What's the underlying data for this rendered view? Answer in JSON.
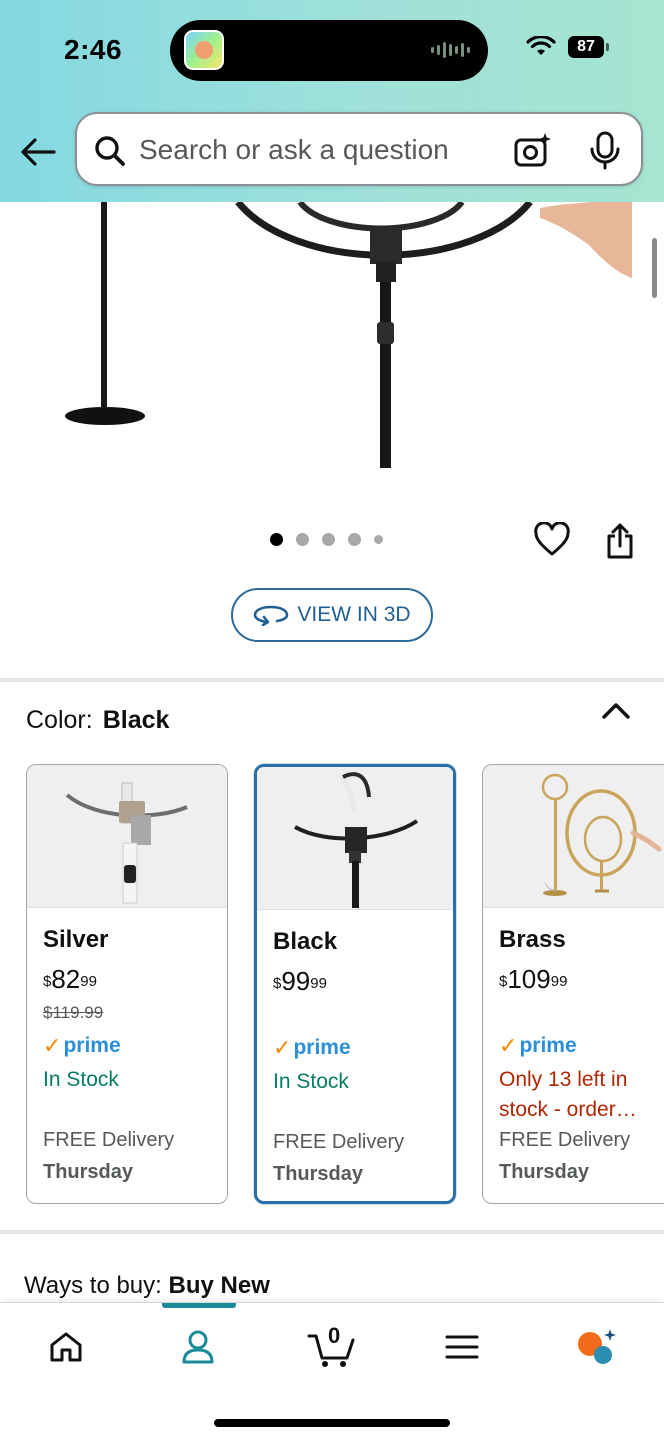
{
  "status_bar": {
    "time": "2:46",
    "battery": "87"
  },
  "header": {
    "search_placeholder": "Search or ask a question"
  },
  "product_view": {
    "view_3d_label": "VIEW IN 3D",
    "image_count": 5,
    "active_image": 1
  },
  "color_selector": {
    "label": "Color:",
    "selected": "Black",
    "options": [
      {
        "name": "Silver",
        "price_symbol": "$",
        "price_whole": "82",
        "price_fraction": "99",
        "list_price": "$119.99",
        "prime": "prime",
        "stock": "In Stock",
        "stock_status": "in-stock",
        "delivery": "FREE Delivery",
        "delivery_day": "Thursday"
      },
      {
        "name": "Black",
        "price_symbol": "$",
        "price_whole": "99",
        "price_fraction": "99",
        "list_price": "",
        "prime": "prime",
        "stock": "In Stock",
        "stock_status": "in-stock",
        "delivery": "FREE Delivery",
        "delivery_day": "Thursday"
      },
      {
        "name": "Brass",
        "price_symbol": "$",
        "price_whole": "109",
        "price_fraction": "99",
        "list_price": "",
        "prime": "prime",
        "stock": "Only 13 left in stock - order…",
        "stock_status": "low",
        "delivery": "FREE Delivery",
        "delivery_day": "Thursday"
      }
    ]
  },
  "ways_to_buy": {
    "label": "Ways to buy:",
    "value": "Buy New"
  },
  "bottom_nav": {
    "items": [
      {
        "icon": "home-icon"
      },
      {
        "icon": "profile-icon",
        "active": true
      },
      {
        "icon": "cart-icon",
        "count": "0"
      },
      {
        "icon": "menu-icon"
      },
      {
        "icon": "rufus-assistant-icon"
      }
    ]
  },
  "colors": {
    "accent": "#2a6fa8",
    "prime_blue": "#2a8fd6",
    "in_stock": "#067d62",
    "low_stock": "#b12704",
    "nav_active": "#1a8a9a"
  }
}
